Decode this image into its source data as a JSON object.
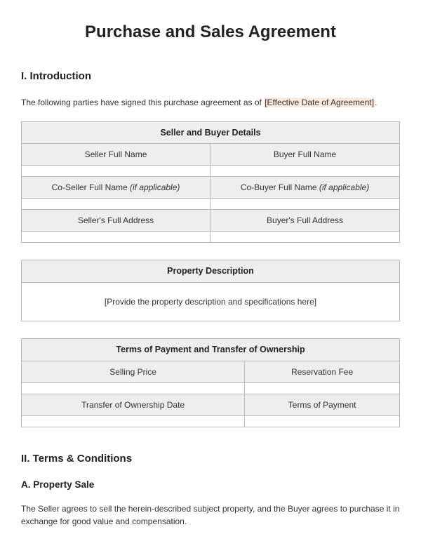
{
  "title": "Purchase and Sales Agreement",
  "section1": {
    "heading": "I. Introduction",
    "intro_before": "The following parties have signed this purchase agreement as of ",
    "intro_highlight": "[Effective Date of Agreement]",
    "intro_after": "."
  },
  "table1": {
    "title": "Seller and Buyer Details",
    "row1_left": "Seller Full Name",
    "row1_right": "Buyer Full Name",
    "row2_left_a": "Co-Seller Full Name ",
    "row2_left_b": "(if applicable)",
    "row2_right_a": "Co-Buyer Full Name ",
    "row2_right_b": "(if applicable)",
    "row3_left": "Seller's Full Address",
    "row3_right": "Buyer's Full Address"
  },
  "table2": {
    "title": "Property Description",
    "placeholder": "[Provide the property description and specifications here]"
  },
  "table3": {
    "title": "Terms of Payment and Transfer of Ownership",
    "row1_left": "Selling Price",
    "row1_right": "Reservation Fee",
    "row2_left": "Transfer of Ownership Date",
    "row2_right": "Terms of Payment"
  },
  "section2": {
    "heading": "II. Terms & Conditions",
    "sub_a": "A. Property Sale",
    "para_a": "The Seller agrees to sell the herein-described subject property, and the Buyer agrees to purchase it in exchange for good value and compensation."
  }
}
